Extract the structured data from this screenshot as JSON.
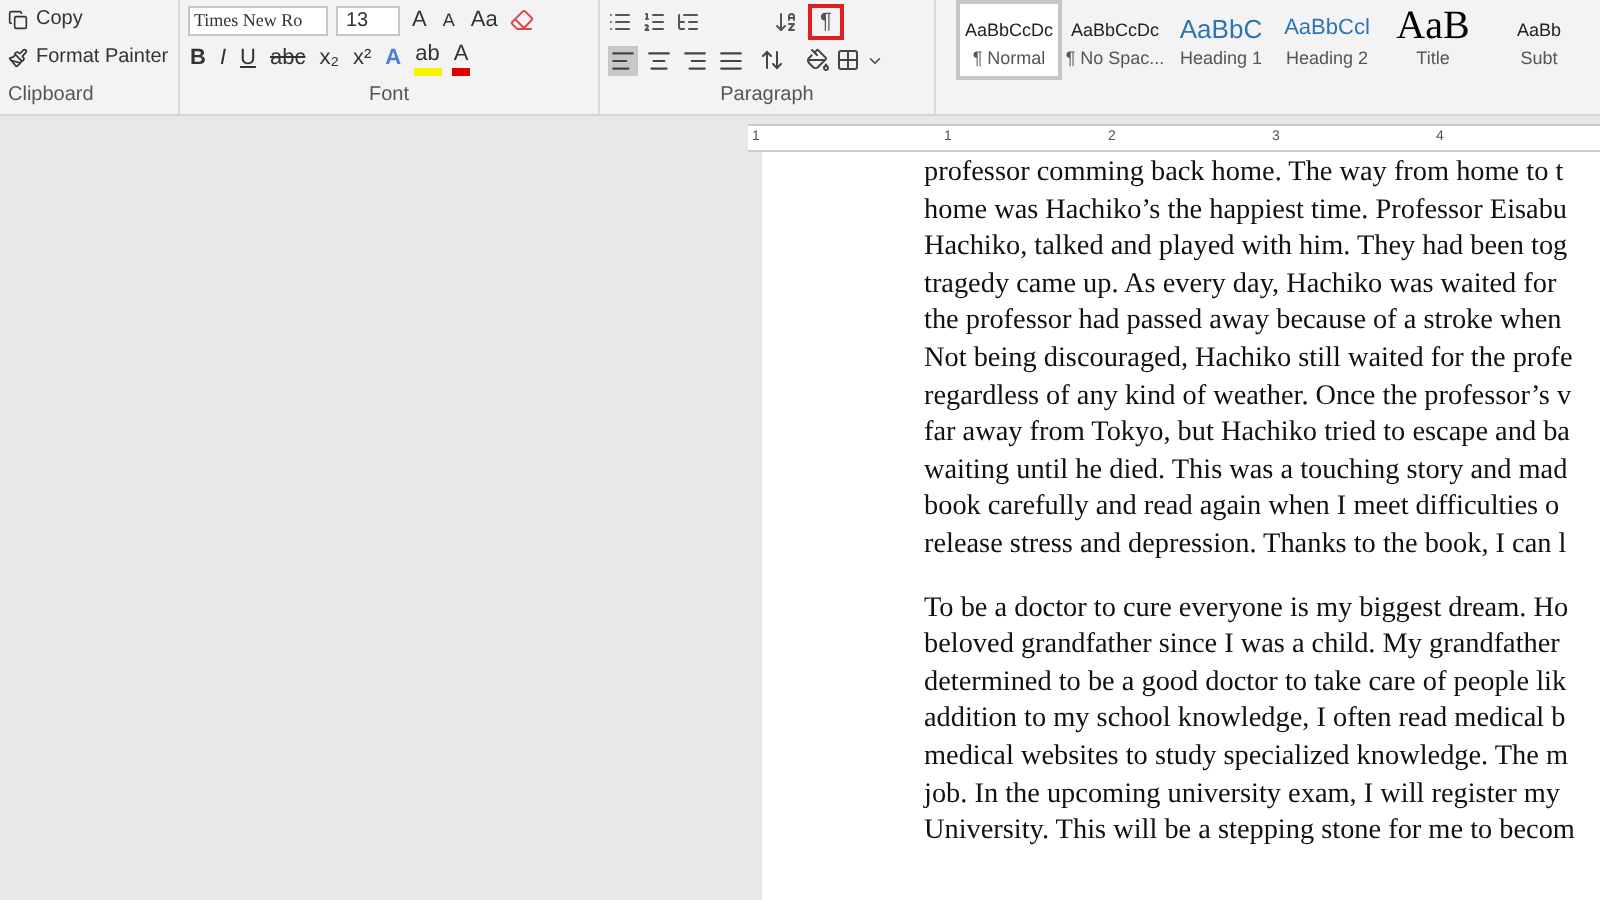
{
  "clipboard": {
    "items": [
      "Copy",
      "Format Painter"
    ],
    "label": "Clipboard"
  },
  "font": {
    "name": "Times New Ro",
    "size": "13",
    "top_buttons": [
      "A",
      "A",
      "Aa"
    ],
    "format_buttons": [
      {
        "label": "B",
        "kind": "bold"
      },
      {
        "label": "I",
        "kind": "italic"
      },
      {
        "label": "U",
        "kind": "underline"
      },
      {
        "label": "abc",
        "kind": "strike"
      },
      {
        "label": "x₂",
        "kind": "plain"
      },
      {
        "label": "x²",
        "kind": "plain"
      },
      {
        "label": "A",
        "kind": "effects"
      },
      {
        "label": "ab",
        "kind": "highlight"
      },
      {
        "label": "A",
        "kind": "color"
      }
    ],
    "label": "Font"
  },
  "paragraph": {
    "label": "Paragraph",
    "show_marks": {
      "label": "¶",
      "annotated": true
    },
    "align": [
      {
        "kind": "left",
        "selected": true
      },
      {
        "kind": "center",
        "selected": false
      },
      {
        "kind": "right",
        "selected": false
      },
      {
        "kind": "justify",
        "selected": false
      }
    ]
  },
  "styles": [
    {
      "preview": "AaBbCcDc",
      "name": "¶ Normal",
      "kind": "normal",
      "selected": true
    },
    {
      "preview": "AaBbCcDc",
      "name": "¶ No Spac...",
      "kind": "normal",
      "selected": false
    },
    {
      "preview": "AaBbC",
      "name": "Heading 1",
      "kind": "heading1",
      "selected": false
    },
    {
      "preview": "AaBbCcl",
      "name": "Heading 2",
      "kind": "heading2",
      "selected": false
    },
    {
      "preview": "AaB",
      "name": "Title",
      "kind": "title",
      "selected": false
    },
    {
      "preview": "AaBb",
      "name": "Subt",
      "kind": "normal",
      "selected": false
    }
  ],
  "ruler": [
    "1",
    "1",
    "2",
    "3",
    "4"
  ],
  "document": {
    "paragraphs": [
      [
        "professor comming back home. The way from home to t",
        "home was Hachiko’s the happiest time. Professor Eisabu",
        "Hachiko, talked and played with him. They had been tog",
        "tragedy came up. As every day, Hachiko was waited for",
        "the professor had passed away because of a stroke when",
        "Not being discouraged, Hachiko still waited for the profe",
        "regardless of any kind of weather. Once the professor’s v",
        "far away from Tokyo, but Hachiko tried to escape and ba",
        "waiting until he died. This was a touching story and mad",
        "book carefully and read again when I meet difficulties o",
        "release stress and depression. Thanks to the book, I can l"
      ],
      [
        "To be a doctor to cure everyone is my biggest dream. Ho",
        "beloved grandfather since I was a child. My grandfather",
        "determined to be a good doctor to take care of people lik",
        "addition to my school knowledge, I often read medical b",
        "medical websites to study specialized knowledge. The m",
        "job. In the upcoming university exam, I will register my",
        "University. This will be a stepping stone for me to becom"
      ]
    ]
  }
}
